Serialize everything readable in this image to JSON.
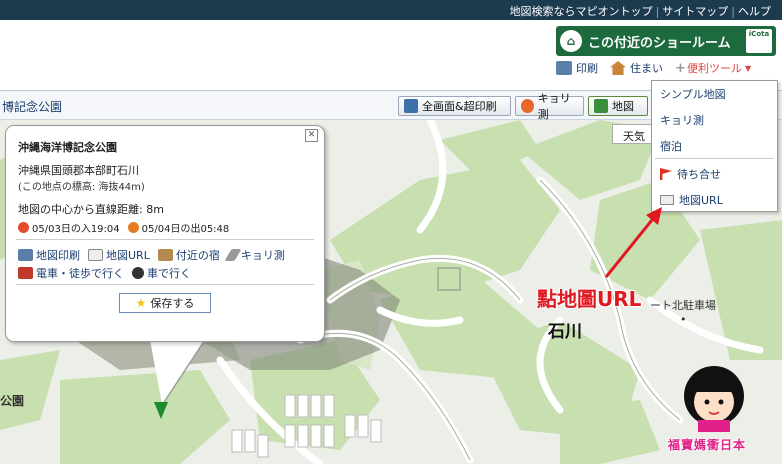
{
  "topbar": {
    "links": [
      "地図検索ならマピオントップ",
      "サイトマップ",
      "ヘルプ"
    ]
  },
  "header": {
    "showroom_label": "この付近のショールーム",
    "showroom_badge": "iCota",
    "tools": {
      "print": "印刷",
      "housing": "住まい",
      "benri": "便利ツール"
    }
  },
  "mapbar": {
    "title": "博記念公園",
    "buttons": {
      "fullscreen": "全画面&超印刷",
      "distance": "キョリ測",
      "map": "地図"
    }
  },
  "map": {
    "tenki": "天気",
    "labels": {
      "ishikawa": "石川",
      "parking": "ート北駐車場",
      "park": "公園"
    }
  },
  "popup": {
    "title": "沖縄海洋博記念公園",
    "address": "沖縄県国頭郡本部町石川",
    "elevation": "(この地点の標高: 海抜44m)",
    "distance": "地図の中心から直線距離: 8m",
    "sunset": "05/03日の入19:04",
    "sunrise": "05/04日の出05:48",
    "links": {
      "map_print": "地図印刷",
      "map_url": "地図URL",
      "nearby_inn": "付近の宿",
      "kyori": "キョリ測",
      "train_walk": "電車・徒歩で行く",
      "car": "車で行く"
    },
    "save_label": "保存する",
    "close_glyph": "✕"
  },
  "dropdown": {
    "items": [
      "シンプル地図",
      "キョリ測",
      "宿泊"
    ],
    "meetup": "待ち合せ",
    "map_url": "地図URL"
  },
  "annotation": {
    "text": "點地圖URL"
  },
  "watermark": {
    "text": "福寶媽衝日本"
  },
  "colors": {
    "accent_red": "#e01820",
    "link_blue": "#1a3d6e",
    "showroom_green": "#1e6a3f",
    "watermark_pink": "#e0218a"
  }
}
